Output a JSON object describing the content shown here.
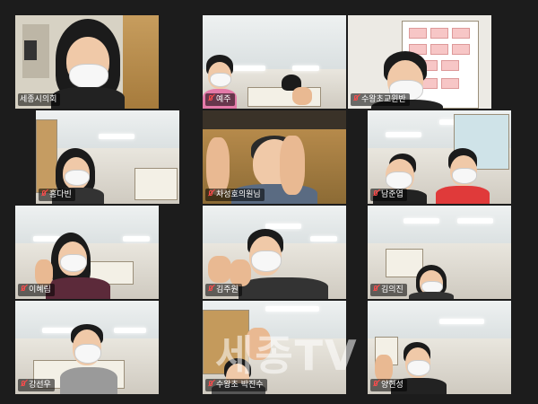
{
  "meeting": {
    "participants": [
      {
        "name": "세종시의회",
        "muted": false,
        "active": true
      },
      {
        "name": "예주",
        "muted": true
      },
      {
        "name": "수왕초교윈반",
        "muted": true
      },
      {
        "name": "홍다빈",
        "muted": true
      },
      {
        "name": "차성호의원님",
        "muted": true
      },
      {
        "name": "남준엽",
        "muted": true
      },
      {
        "name": "이혜림",
        "muted": true
      },
      {
        "name": "김주원",
        "muted": true
      },
      {
        "name": "김의진",
        "muted": true
      },
      {
        "name": "강선우",
        "muted": true
      },
      {
        "name": "수왕초 박진수",
        "muted": true
      },
      {
        "name": "양현성",
        "muted": true
      }
    ]
  },
  "watermark": "세종TV"
}
